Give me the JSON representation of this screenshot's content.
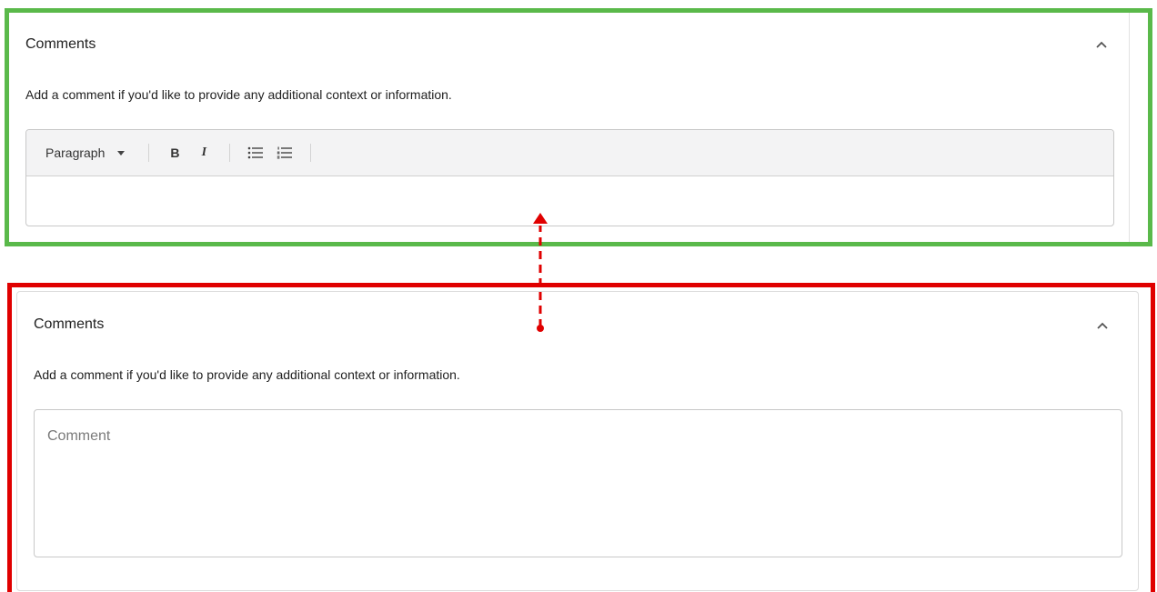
{
  "before_panel": {
    "title": "Comments",
    "description": "Add a comment if you'd like to provide any additional context or information.",
    "toolbar": {
      "format_label": "Paragraph",
      "bold_label": "B",
      "italic_label": "I"
    }
  },
  "after_panel": {
    "title": "Comments",
    "description": "Add a comment if you'd like to provide any additional context or information.",
    "comment_placeholder": "Comment"
  },
  "colors": {
    "highlight_good": "#5ab94a",
    "highlight_bad": "#e00000",
    "arrow": "#e00000"
  },
  "icons": {
    "collapse": "chevron-up-icon",
    "bullet_list": "bulleted-list-icon",
    "numbered_list": "numbered-list-icon"
  }
}
